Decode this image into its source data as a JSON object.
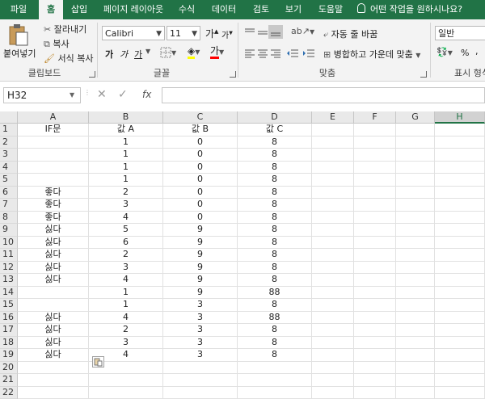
{
  "tabs": [
    "파일",
    "홈",
    "삽입",
    "페이지 레이아웃",
    "수식",
    "데이터",
    "검토",
    "보기",
    "도움말"
  ],
  "tell_me": "어떤 작업을 원하시나요?",
  "ribbon": {
    "paste_label": "붙여넣기",
    "cut_label": "잘라내기",
    "copy_label": "복사",
    "format_painter_label": "서식 복사",
    "clipboard_group": "클립보드",
    "font_name": "Calibri",
    "font_size": "11",
    "font_group": "글꼴",
    "bold": "가",
    "italic": "가",
    "underline": "가",
    "grow_font": "가",
    "shrink_font": "가",
    "wrap_text": "자동 줄 바꿈",
    "merge_center": "병합하고 가운데 맞춤",
    "alignment_group": "맞춤",
    "number_format": "일반",
    "number_group": "표시 형식",
    "percent": "%",
    "comma": ","
  },
  "name_box": "H32",
  "fx_label": "fx",
  "formula": "",
  "columns": [
    "A",
    "B",
    "C",
    "D",
    "E",
    "F",
    "G",
    "H"
  ],
  "selected_column": "H",
  "rows": [
    [
      "IF문",
      "값 A",
      "값 B",
      "값 C"
    ],
    [
      "",
      "1",
      "0",
      "8"
    ],
    [
      "",
      "1",
      "0",
      "8"
    ],
    [
      "",
      "1",
      "0",
      "8"
    ],
    [
      "",
      "1",
      "0",
      "8"
    ],
    [
      "좋다",
      "2",
      "0",
      "8"
    ],
    [
      "좋다",
      "3",
      "0",
      "8"
    ],
    [
      "좋다",
      "4",
      "0",
      "8"
    ],
    [
      "싫다",
      "5",
      "9",
      "8"
    ],
    [
      "싫다",
      "6",
      "9",
      "8"
    ],
    [
      "싫다",
      "2",
      "9",
      "8"
    ],
    [
      "싫다",
      "3",
      "9",
      "8"
    ],
    [
      "싫다",
      "4",
      "9",
      "8"
    ],
    [
      "",
      "1",
      "9",
      "88"
    ],
    [
      "",
      "1",
      "3",
      "8"
    ],
    [
      "싫다",
      "4",
      "3",
      "88"
    ],
    [
      "싫다",
      "2",
      "3",
      "8"
    ],
    [
      "싫다",
      "3",
      "3",
      "8"
    ],
    [
      "싫다",
      "4",
      "3",
      "8"
    ],
    [
      "",
      "",
      "",
      ""
    ],
    [
      "",
      "",
      "",
      ""
    ],
    [
      "",
      "",
      "",
      ""
    ]
  ],
  "row_numbers": [
    "1",
    "2",
    "3",
    "4",
    "5",
    "6",
    "7",
    "8",
    "9",
    "10",
    "11",
    "12",
    "13",
    "14",
    "15",
    "16",
    "17",
    "18",
    "19",
    "20",
    "21",
    "22"
  ]
}
